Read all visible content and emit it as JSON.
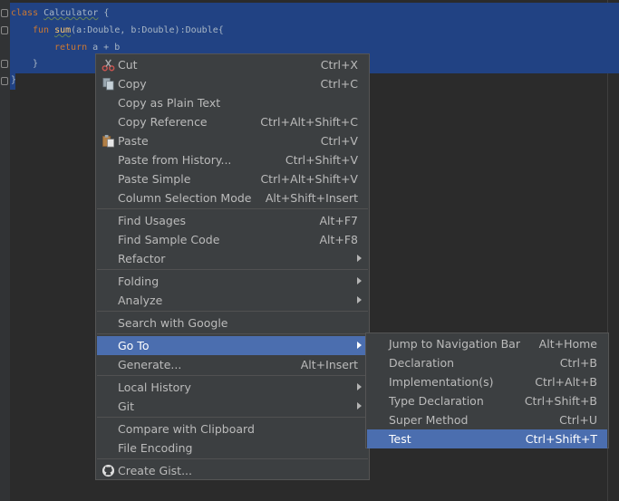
{
  "editor": {
    "line1": {
      "kw": "class",
      "name": "Calculator",
      "rest": " {"
    },
    "line2": {
      "kw": "fun",
      "name": "sum",
      "rest": "(a:Double, b:Double):Double{"
    },
    "line3": {
      "kw": "return",
      "rest": " a + b"
    },
    "line4": {
      "text": "}"
    },
    "line5": {
      "text": "}"
    }
  },
  "context_menu": {
    "cut": {
      "label": "Cut",
      "shortcut": "Ctrl+X",
      "icon": "scissors-icon"
    },
    "copy": {
      "label": "Copy",
      "shortcut": "Ctrl+C",
      "icon": "copy-icon"
    },
    "copy_plain": {
      "label": "Copy as Plain Text"
    },
    "copy_reference": {
      "label": "Copy Reference",
      "shortcut": "Ctrl+Alt+Shift+C"
    },
    "paste": {
      "label": "Paste",
      "shortcut": "Ctrl+V",
      "icon": "clipboard-icon"
    },
    "paste_history": {
      "label": "Paste from History...",
      "shortcut": "Ctrl+Shift+V"
    },
    "paste_simple": {
      "label": "Paste Simple",
      "shortcut": "Ctrl+Alt+Shift+V"
    },
    "column_selection": {
      "label": "Column Selection Mode",
      "shortcut": "Alt+Shift+Insert"
    },
    "find_usages": {
      "label": "Find Usages",
      "shortcut": "Alt+F7"
    },
    "find_sample": {
      "label": "Find Sample Code",
      "shortcut": "Alt+F8"
    },
    "refactor": {
      "label": "Refactor"
    },
    "folding": {
      "label": "Folding"
    },
    "analyze": {
      "label": "Analyze"
    },
    "search_google": {
      "label": "Search with Google"
    },
    "go_to": {
      "label": "Go To"
    },
    "generate": {
      "label": "Generate...",
      "shortcut": "Alt+Insert"
    },
    "local_history": {
      "label": "Local History"
    },
    "git": {
      "label": "Git"
    },
    "compare_clipboard": {
      "label": "Compare with Clipboard"
    },
    "file_encoding": {
      "label": "File Encoding"
    },
    "create_gist": {
      "label": "Create Gist...",
      "icon": "github-icon"
    }
  },
  "goto_submenu": {
    "jump_nav": {
      "label": "Jump to Navigation Bar",
      "shortcut": "Alt+Home"
    },
    "declaration": {
      "label": "Declaration",
      "shortcut": "Ctrl+B"
    },
    "implementation": {
      "label": "Implementation(s)",
      "shortcut": "Ctrl+Alt+B"
    },
    "type_declaration": {
      "label": "Type Declaration",
      "shortcut": "Ctrl+Shift+B"
    },
    "super_method": {
      "label": "Super Method",
      "shortcut": "Ctrl+U"
    },
    "test": {
      "label": "Test",
      "shortcut": "Ctrl+Shift+T"
    }
  },
  "colors": {
    "editor_bg": "#2b2b2b",
    "selection": "#214283",
    "menu_bg": "#3c3f41",
    "menu_highlight": "#4b6eaf",
    "keyword": "#cc7832"
  }
}
